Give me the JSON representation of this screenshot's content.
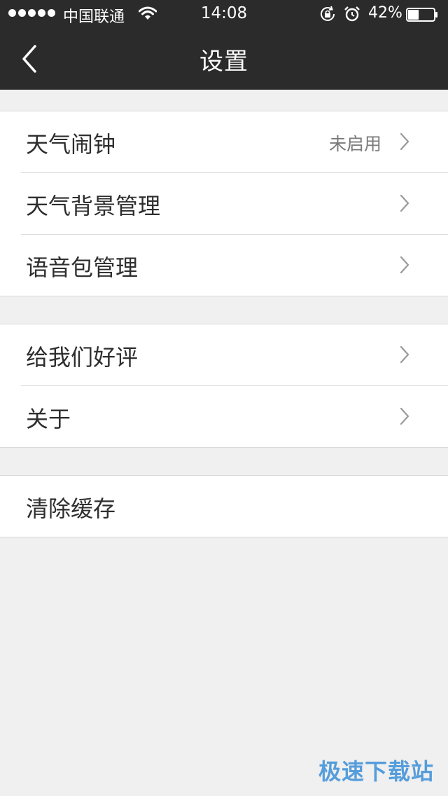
{
  "status_bar": {
    "carrier": "中国联通",
    "time": "14:08",
    "battery_percent": "42%",
    "battery_level": 0.42,
    "signal_bars": 5
  },
  "nav": {
    "title": "设置",
    "back_icon": "chevron-left-icon"
  },
  "groups": [
    {
      "items": [
        {
          "label": "天气闹钟",
          "value": "未启用"
        },
        {
          "label": "天气背景管理"
        },
        {
          "label": "语音包管理"
        }
      ]
    },
    {
      "items": [
        {
          "label": "给我们好评"
        },
        {
          "label": "关于"
        }
      ]
    },
    {
      "items": [
        {
          "label": "清除缓存"
        }
      ]
    }
  ],
  "watermark": "极速下载站",
  "colors": {
    "header_bg": "#2b2b2b",
    "page_bg": "#f0f0f0",
    "row_bg": "#ffffff",
    "watermark": "#3c8fd8"
  }
}
